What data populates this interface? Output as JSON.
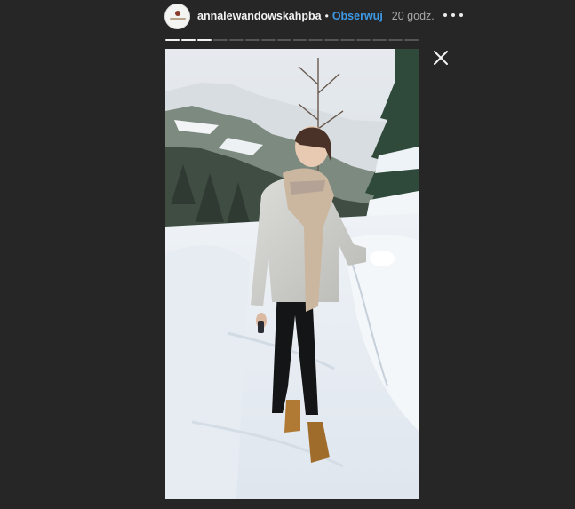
{
  "header": {
    "username": "annalewandowskahpba",
    "separator": "•",
    "follow_label": "Obserwuj",
    "time": "20 godz."
  },
  "icons": {
    "more": "more-horizontal-icon",
    "close": "close-icon",
    "avatar": "profile-avatar"
  },
  "story": {
    "segments_total": 16,
    "segments_viewed": 3,
    "media": "photo of a woman in a winter jacket and scarf walking on a snowy mountain path"
  },
  "colors": {
    "background": "#262626",
    "follow": "#3d9ae8",
    "username": "#f2f2f2",
    "time": "#a8a8a8"
  }
}
